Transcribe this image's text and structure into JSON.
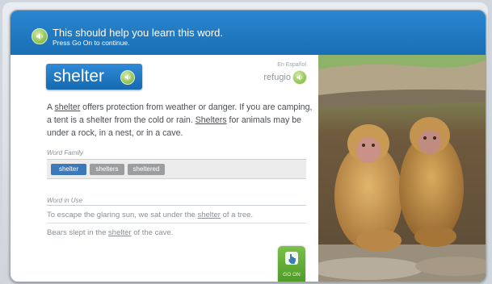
{
  "header": {
    "title": "This should help you learn this word.",
    "subtitle": "Press Go On to continue.",
    "speaker_icon": "speaker-icon"
  },
  "word": {
    "text": "shelter",
    "spanish_label": "En Español",
    "spanish_word": "refugio"
  },
  "definition": {
    "p1": "A ",
    "w1": "shelter",
    "p2": " offers protection from weather or danger. If you are camping, a tent is a shelter from the cold or rain. ",
    "w2": "Shelters",
    "p3": " for animals may be under a rock, in a nest, or in a cave."
  },
  "word_family": {
    "label": "Word Family",
    "items": [
      "shelter",
      "shelters",
      "sheltered"
    ],
    "active_index": 0
  },
  "word_in_use": {
    "label": "Word in Use",
    "s1_before": "To escape the glaring sun, we sat under the ",
    "s1_word": "shelter",
    "s1_after": " of a tree.",
    "s2_before": "Bears slept in the ",
    "s2_word": "shelter",
    "s2_after": " of the cave."
  },
  "go_on": {
    "label": "GO ON",
    "icon": "pointing-hand-icon"
  },
  "colors": {
    "header_blue": "#1f77c0",
    "word_blue": "#2378c3",
    "speaker_green": "#6aac2a",
    "go_green": "#5fa833"
  }
}
